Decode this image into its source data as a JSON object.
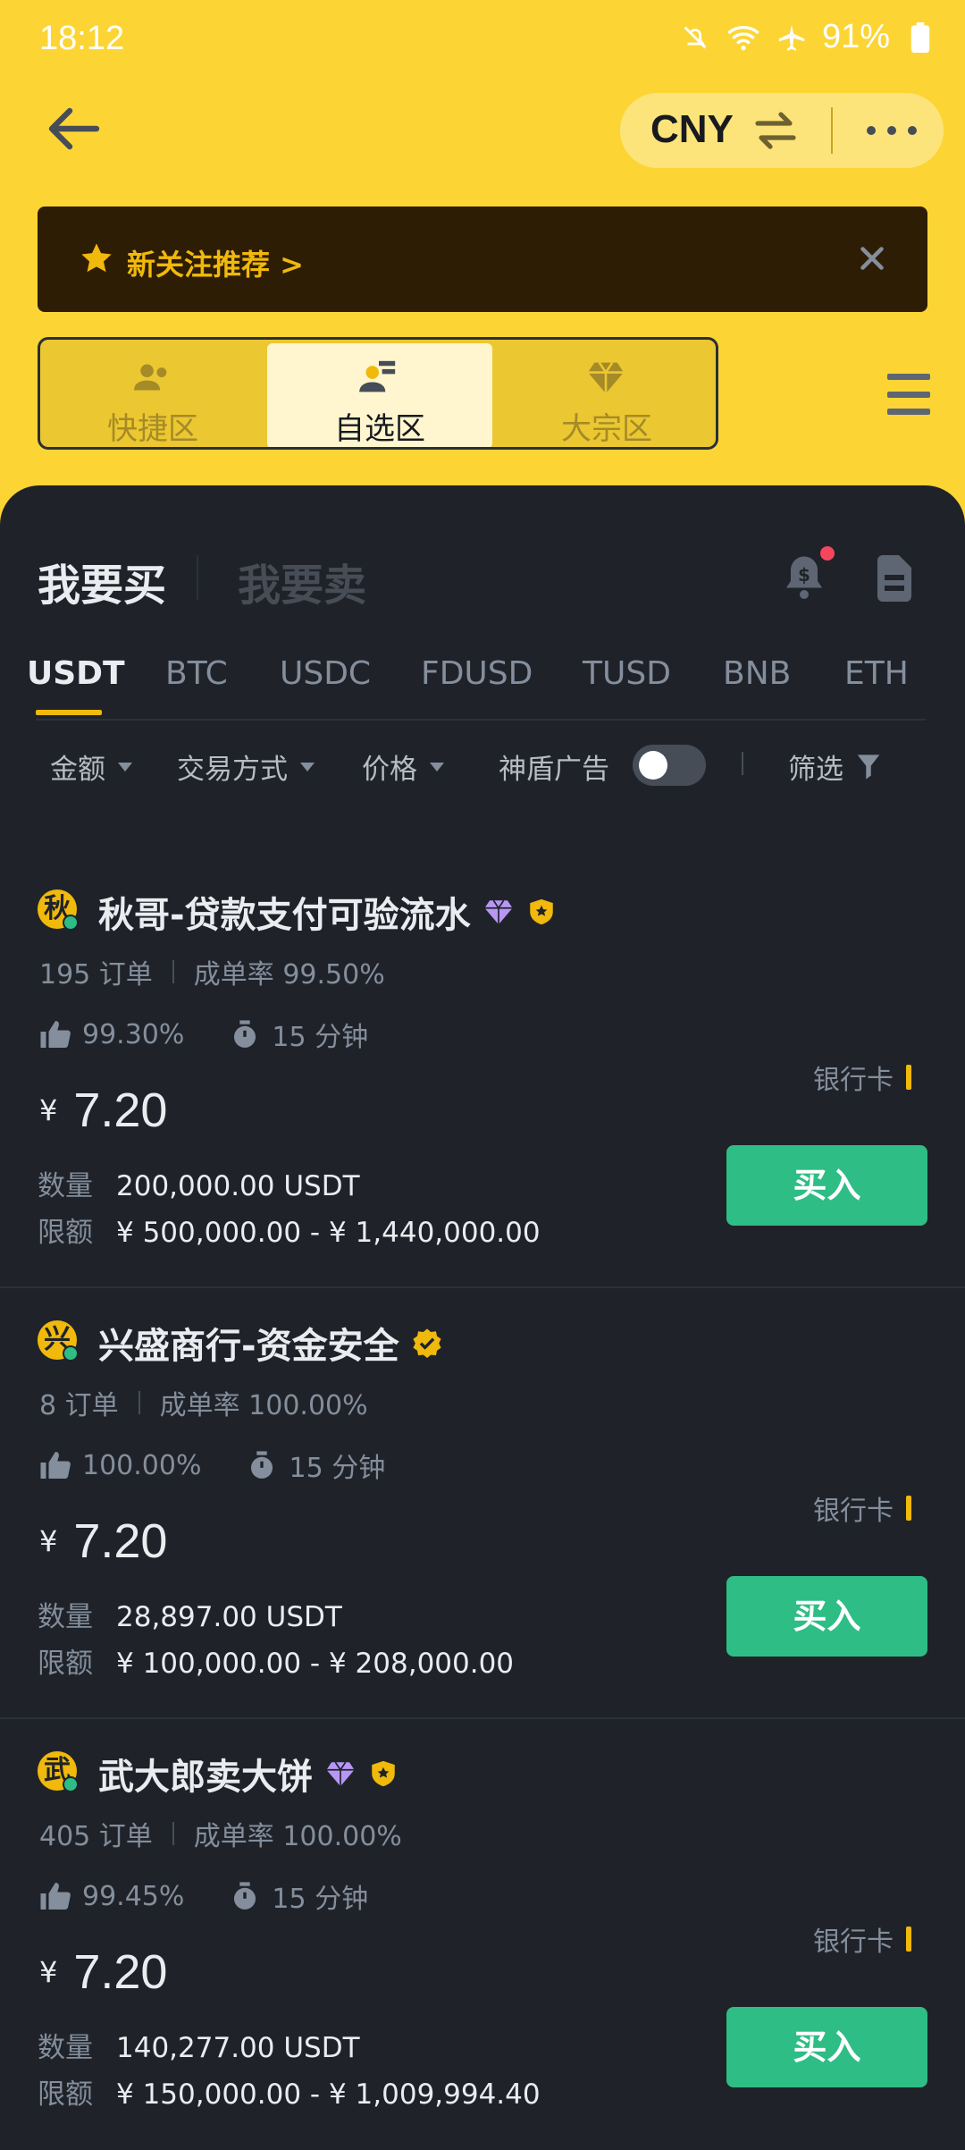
{
  "status_bar": {
    "time": "18:12",
    "battery": "91%"
  },
  "header": {
    "currency": "CNY"
  },
  "banner": {
    "text": "新关注推荐 >"
  },
  "zones": [
    {
      "label": "快捷区",
      "icon": "users-icon",
      "active": false
    },
    {
      "label": "自选区",
      "icon": "select-users-icon",
      "active": true
    },
    {
      "label": "大宗区",
      "icon": "diamond-icon",
      "active": false
    }
  ],
  "side_tabs": {
    "buy": "我要买",
    "sell": "我要卖"
  },
  "coins": [
    "USDT",
    "BTC",
    "USDC",
    "FDUSD",
    "TUSD",
    "BNB",
    "ETH"
  ],
  "active_coin": "USDT",
  "filters": {
    "amount": "金额",
    "payment": "交易方式",
    "price": "价格",
    "shield": "神盾广告",
    "shield_on": false,
    "filter": "筛选"
  },
  "ads": [
    {
      "avatar": "秋",
      "name": "秋哥-贷款支付可验流水",
      "badges": [
        "diamond-badge",
        "shield-badge"
      ],
      "orders": "195 订单",
      "completion": "成单率 99.50%",
      "positive": "99.30%",
      "time": "15 分钟",
      "currency_symbol": "¥",
      "price": "7.20",
      "payment": "银行卡",
      "quantity_label": "数量",
      "quantity": "200,000.00 USDT",
      "limit_label": "限额",
      "limit": "¥ 500,000.00 - ¥ 1,440,000.00",
      "action": "买入"
    },
    {
      "avatar": "兴",
      "name": "兴盛商行-资金安全",
      "badges": [
        "verified-badge"
      ],
      "orders": "8 订单",
      "completion": "成单率 100.00%",
      "positive": "100.00%",
      "time": "15 分钟",
      "currency_symbol": "¥",
      "price": "7.20",
      "payment": "银行卡",
      "quantity_label": "数量",
      "quantity": "28,897.00 USDT",
      "limit_label": "限额",
      "limit": "¥ 100,000.00 - ¥ 208,000.00",
      "action": "买入"
    },
    {
      "avatar": "武",
      "name": "武大郎卖大饼",
      "badges": [
        "diamond-badge",
        "shield-badge"
      ],
      "orders": "405 订单",
      "completion": "成单率 100.00%",
      "positive": "99.45%",
      "time": "15 分钟",
      "currency_symbol": "¥",
      "price": "7.20",
      "payment": "银行卡",
      "quantity_label": "数量",
      "quantity": "140,277.00 USDT",
      "limit_label": "限额",
      "limit": "¥ 150,000.00 - ¥ 1,009,994.40",
      "action": "买入"
    }
  ],
  "colors": {
    "brand_yellow": "#fcd535",
    "buy_green": "#2ebd85",
    "background": "#1f2329",
    "accent": "#f0b90b"
  }
}
